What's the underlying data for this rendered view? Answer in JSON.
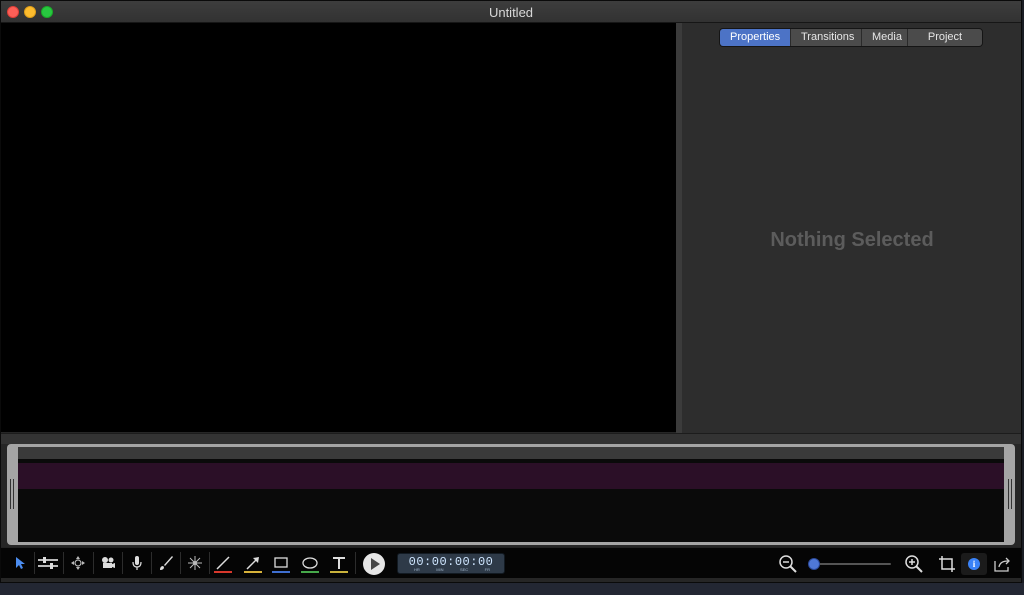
{
  "window": {
    "title": "Untitled"
  },
  "right_panel": {
    "tabs": [
      {
        "label": "Properties",
        "active": true
      },
      {
        "label": "Transitions",
        "active": false
      },
      {
        "label": "Media",
        "active": false
      },
      {
        "label": "Project Info",
        "active": false
      }
    ],
    "empty_message": "Nothing Selected"
  },
  "toolbar": {
    "tools": [
      {
        "icon": "arrow-pointer-icon",
        "selected": true
      },
      {
        "icon": "track-adjust-icon"
      },
      {
        "icon": "move-icon"
      },
      {
        "icon": "camera-icon"
      },
      {
        "icon": "microphone-icon"
      },
      {
        "icon": "brush-icon"
      },
      {
        "icon": "sparkle-icon"
      },
      {
        "icon": "line-icon",
        "underline_color": "#d8382c"
      },
      {
        "icon": "arrow-icon",
        "underline_color": "#d7b23a"
      },
      {
        "icon": "rectangle-icon",
        "underline_color": "#3f6fd0"
      },
      {
        "icon": "ellipse-icon",
        "underline_color": "#46a84a"
      },
      {
        "icon": "text-icon",
        "underline_color": "#c9b23c"
      }
    ],
    "timecode": {
      "value": "00:00:00:00",
      "units": [
        "HR",
        "MIN",
        "SEC",
        "FR"
      ]
    },
    "zoom_level": 0.02,
    "accent_color": "#4c73c6"
  },
  "timeline": {
    "track_color": "#2b0f27"
  }
}
